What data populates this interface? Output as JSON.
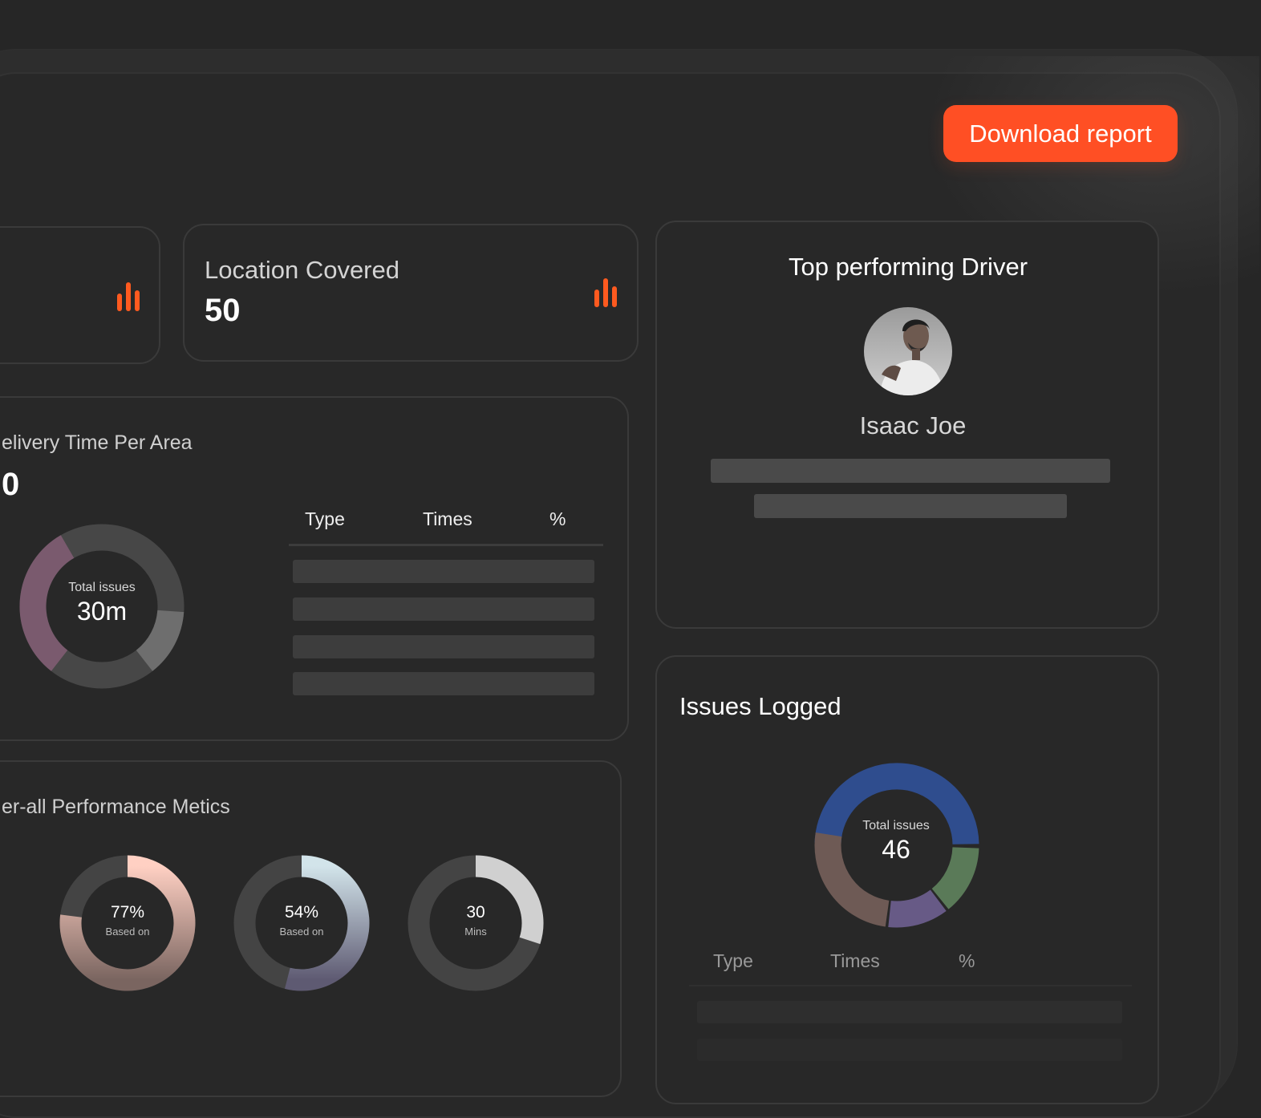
{
  "header": {
    "download_label": "Download report"
  },
  "stats": {
    "location": {
      "title": "Location Covered",
      "value": "50"
    }
  },
  "delivery": {
    "title": "elivery Time Per Area",
    "value": "0",
    "donut": {
      "label": "Total issues",
      "value": "30m"
    },
    "table": {
      "headers": [
        "Type",
        "Times",
        "%"
      ]
    }
  },
  "performance": {
    "title": "er-all Performance Metics",
    "gauges": [
      {
        "value": "77%",
        "label": "Based on",
        "fraction": 0.77
      },
      {
        "value": "54%",
        "label": "Based on",
        "fraction": 0.54
      },
      {
        "value": "30",
        "label": "Mins",
        "fraction": 0.3
      }
    ]
  },
  "driver": {
    "title": "Top performing Driver",
    "name": "Isaac Joe"
  },
  "issues": {
    "title": "Issues Logged",
    "donut": {
      "label": "Total issues",
      "value": "46"
    },
    "table": {
      "headers": [
        "Type",
        "Times",
        "%"
      ]
    }
  },
  "colors": {
    "accent": "#ff4f24",
    "chart_blue": "#2f4d8e",
    "chart_green": "#5a7a58",
    "chart_purple": "#675a86",
    "chart_brown": "#6e5a55",
    "chart_mauve": "#7a5a6e"
  }
}
